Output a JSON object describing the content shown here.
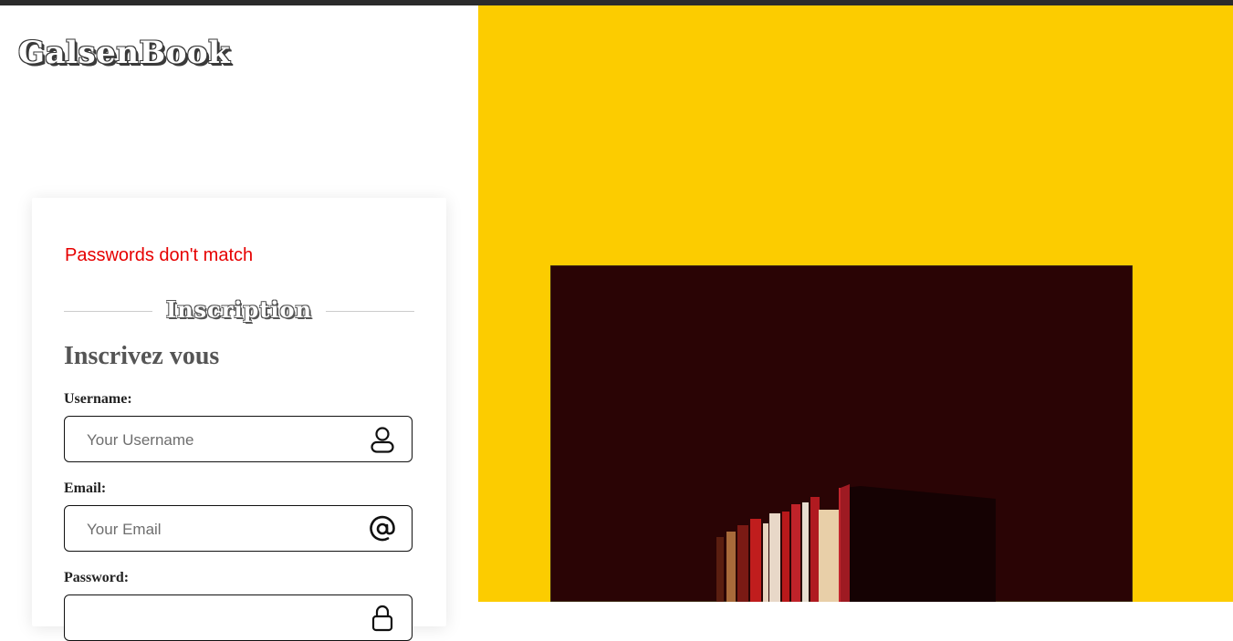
{
  "brand": {
    "name": "GalsenBook"
  },
  "form": {
    "error_message": "Passwords don't match",
    "section_title": "Inscription",
    "subtitle": "Inscrivez vous",
    "fields": [
      {
        "label": "Username:",
        "placeholder": "Your Username",
        "value": "",
        "icon": "user-icon"
      },
      {
        "label": "Email:",
        "placeholder": "Your Email",
        "value": "",
        "icon": "at-sign-icon"
      },
      {
        "label": "Password:",
        "placeholder": "",
        "value": "",
        "icon": "lock-icon"
      }
    ]
  },
  "colors": {
    "accent_yellow": "#fccc00",
    "error_red": "#e60000",
    "image_background": "#2a0405"
  },
  "hero_image": {
    "subject": "books-photo"
  }
}
